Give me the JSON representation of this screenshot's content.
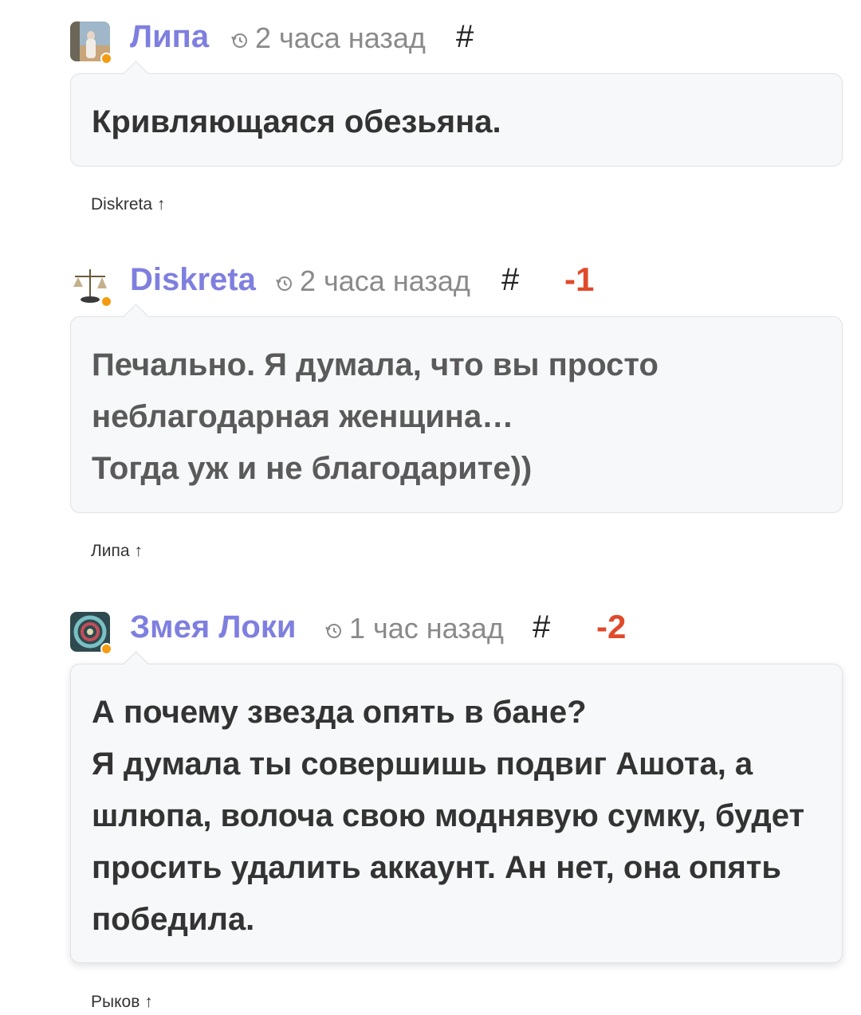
{
  "comments": [
    {
      "author": "Липа",
      "time": "2 часа назад",
      "hash": "#",
      "score": "",
      "text": "Кривляющаяся обезьяна.",
      "reply_to": "Diskreta ↑",
      "avatar_icon": "user-photo-beach",
      "online_color": "#f39c12"
    },
    {
      "author": "Diskreta",
      "time": "2 часа назад",
      "hash": "#",
      "score": "-1",
      "text": "Печально. Я думала, что вы просто\nнеблагодарная женщина…\nТогда уж и не благодарите))",
      "reply_to": "Липа ↑",
      "avatar_icon": "scales-icon",
      "online_color": "#f39c12"
    },
    {
      "author": "Змея Локи",
      "time": "1 час назад",
      "hash": "#",
      "score": "-2",
      "text": "А почему звезда опять в бане?\nЯ думала ты совершишь подвиг Ашота, а\nшлюпа, волоча свою моднявую сумку, будет\nпросить удалить аккаунт. Ан нет, она опять\nпобедила.",
      "reply_to": "Рыков ↑",
      "avatar_icon": "serpent-icon",
      "online_color": "#f39c12"
    }
  ],
  "colors": {
    "author": "#7f7fe0",
    "score_negative": "#e04a2a",
    "bubble_bg": "#f7f8fa"
  },
  "icons": {
    "time": "history-clock-icon"
  }
}
